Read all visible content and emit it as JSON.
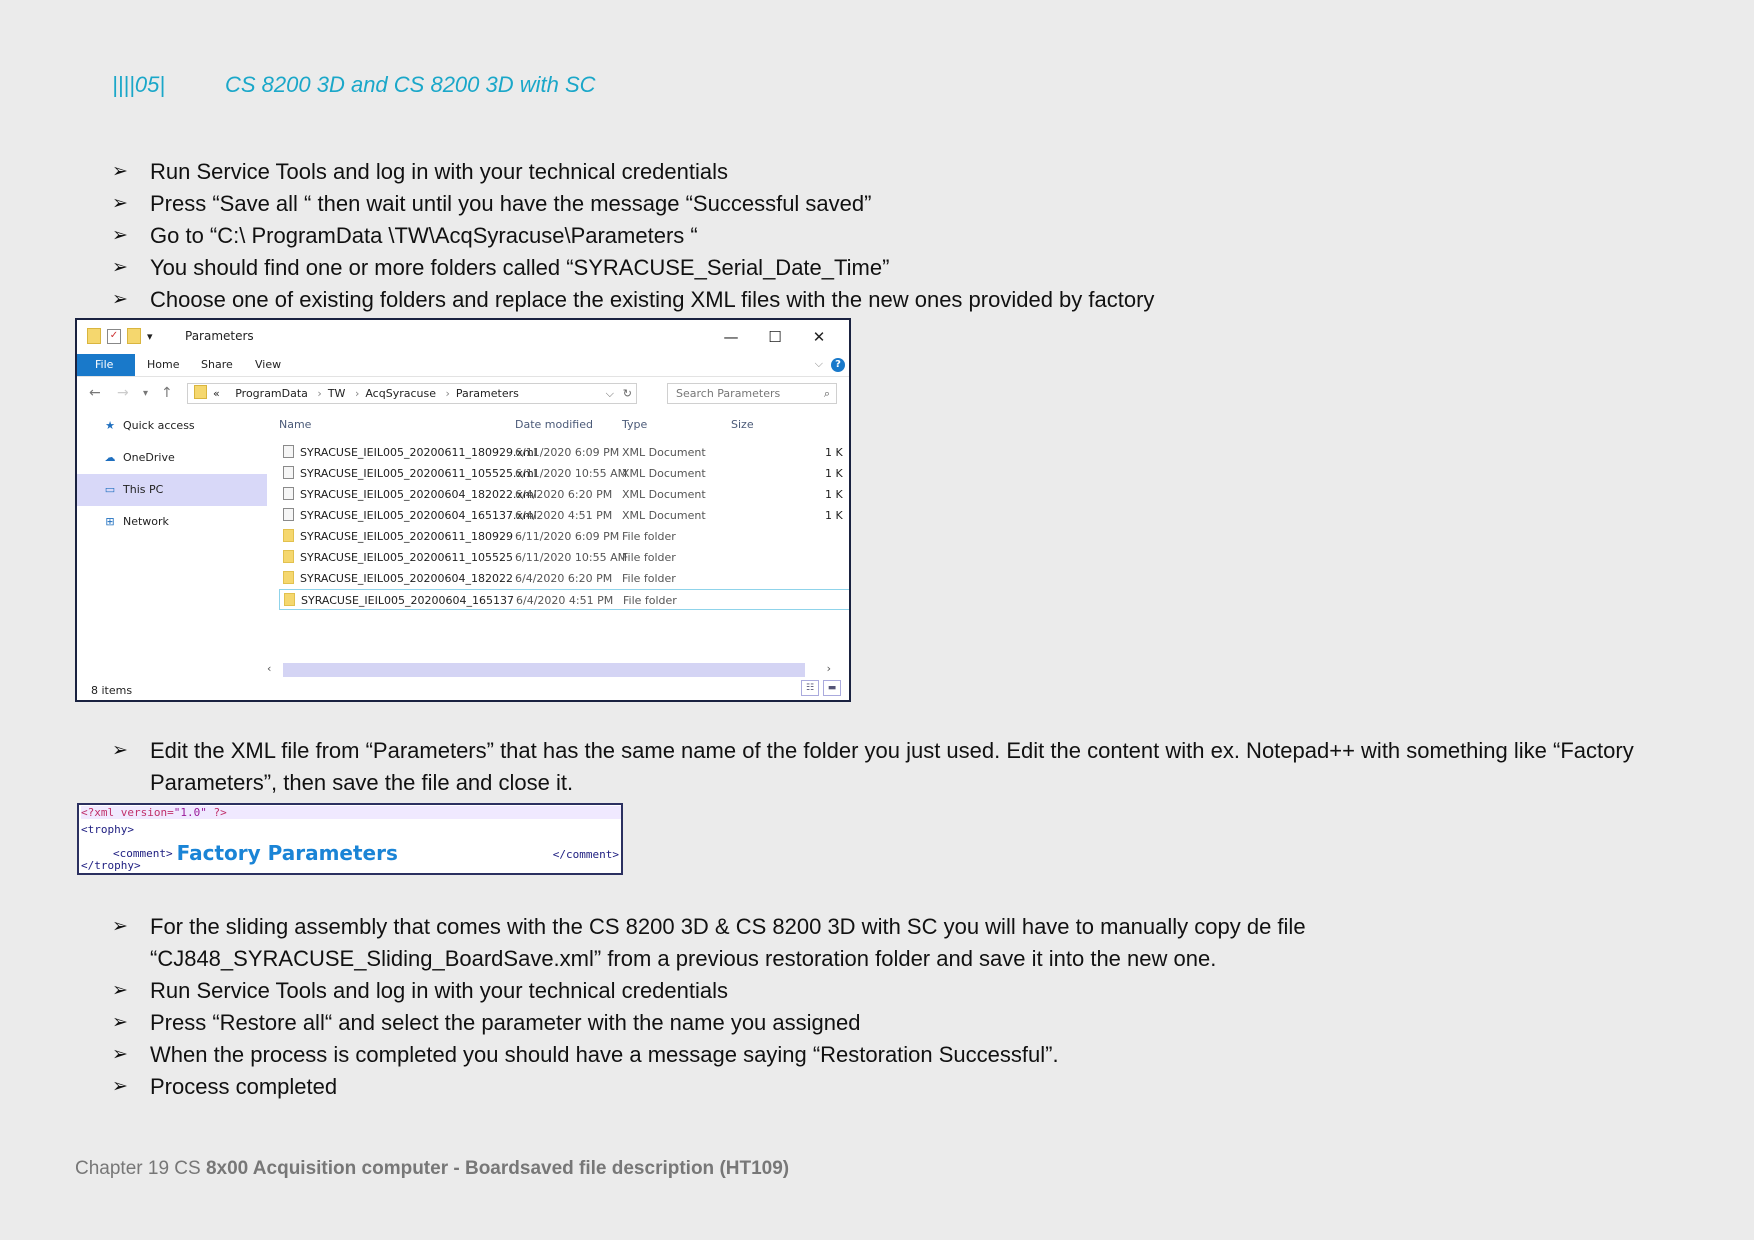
{
  "header": {
    "number": "||||05|",
    "title": "CS 8200 3D and CS 8200 3D with SC"
  },
  "bullet_glyph": "➢",
  "steps_top": [
    "Run Service Tools and log in with your technical credentials",
    "Press “Save all “ then wait until you have the message “Successful saved”",
    "Go to “C:\\ ProgramData \\TW\\AcqSyracuse\\Parameters “",
    "You should find one or more folders called “SYRACUSE_Serial_Date_Time”",
    "Choose one of existing folders and replace the existing XML files with the new ones provided by factory"
  ],
  "explorer": {
    "window_title": "Parameters",
    "window_controls": [
      "—",
      "☐",
      "✕"
    ],
    "ribbon_tabs": [
      "File",
      "Home",
      "Share",
      "View"
    ],
    "address": {
      "prefix": "«",
      "parts": [
        "ProgramData",
        "TW",
        "AcqSyracuse",
        "Parameters"
      ]
    },
    "search_placeholder": "Search Parameters",
    "nav_items": [
      {
        "label": "Quick access",
        "icon": "★",
        "selected": false
      },
      {
        "label": "OneDrive",
        "icon": "☁",
        "selected": false
      },
      {
        "label": "This PC",
        "icon": "▭",
        "selected": true
      },
      {
        "label": "Network",
        "icon": "⊞",
        "selected": false
      }
    ],
    "columns": [
      "Name",
      "Date modified",
      "Type",
      "Size"
    ],
    "files": [
      {
        "name": "SYRACUSE_IEIL005_20200611_180929.xml",
        "date": "6/11/2020 6:09 PM",
        "type": "XML Document",
        "size": "1 K",
        "kind": "xml"
      },
      {
        "name": "SYRACUSE_IEIL005_20200611_105525.xml",
        "date": "6/11/2020 10:55 AM",
        "type": "XML Document",
        "size": "1 K",
        "kind": "xml"
      },
      {
        "name": "SYRACUSE_IEIL005_20200604_182022.xml",
        "date": "6/4/2020 6:20 PM",
        "type": "XML Document",
        "size": "1 K",
        "kind": "xml"
      },
      {
        "name": "SYRACUSE_IEIL005_20200604_165137.xml",
        "date": "6/4/2020 4:51 PM",
        "type": "XML Document",
        "size": "1 K",
        "kind": "xml"
      },
      {
        "name": "SYRACUSE_IEIL005_20200611_180929",
        "date": "6/11/2020 6:09 PM",
        "type": "File folder",
        "size": "",
        "kind": "folder"
      },
      {
        "name": "SYRACUSE_IEIL005_20200611_105525",
        "date": "6/11/2020 10:55 AM",
        "type": "File folder",
        "size": "",
        "kind": "folder"
      },
      {
        "name": "SYRACUSE_IEIL005_20200604_182022",
        "date": "6/4/2020 6:20 PM",
        "type": "File folder",
        "size": "",
        "kind": "folder"
      },
      {
        "name": "SYRACUSE_IEIL005_20200604_165137",
        "date": "6/4/2020 4:51 PM",
        "type": "File folder",
        "size": "",
        "kind": "folder",
        "selected": true
      }
    ],
    "status": "8 items"
  },
  "steps_edit": [
    "Edit the XML file from “Parameters” that has the same name of the folder you just used. Edit the content with ex. Notepad++ with something like “Factory Parameters”, then save the file and close it."
  ],
  "xml_snippet": {
    "line1_decl": "<?xml version=",
    "line1_val": "\"1.0\"",
    "line1_end": " ?>",
    "line2": "<trophy>",
    "line3_open": "<comment>",
    "line3_value": "Factory Parameters",
    "line3_close": "</comment>",
    "line4": "</trophy>"
  },
  "steps_bottom": [
    "For the sliding assembly that comes with the CS 8200 3D & CS 8200 3D with SC you will have to manually copy de file “CJ848_SYRACUSE_Sliding_BoardSave.xml” from a previous restoration folder and save it into the new one.",
    "Run Service Tools and log in with your technical credentials",
    "Press “Restore all“ and select the parameter with the name you assigned",
    "When the process is completed you should have a message saying “Restoration Successful”.",
    "Process completed"
  ],
  "footer": {
    "prefix": "Chapter 19 CS ",
    "bold": "8x00 Acquisition computer - Boardsaved file description (HT109)"
  }
}
